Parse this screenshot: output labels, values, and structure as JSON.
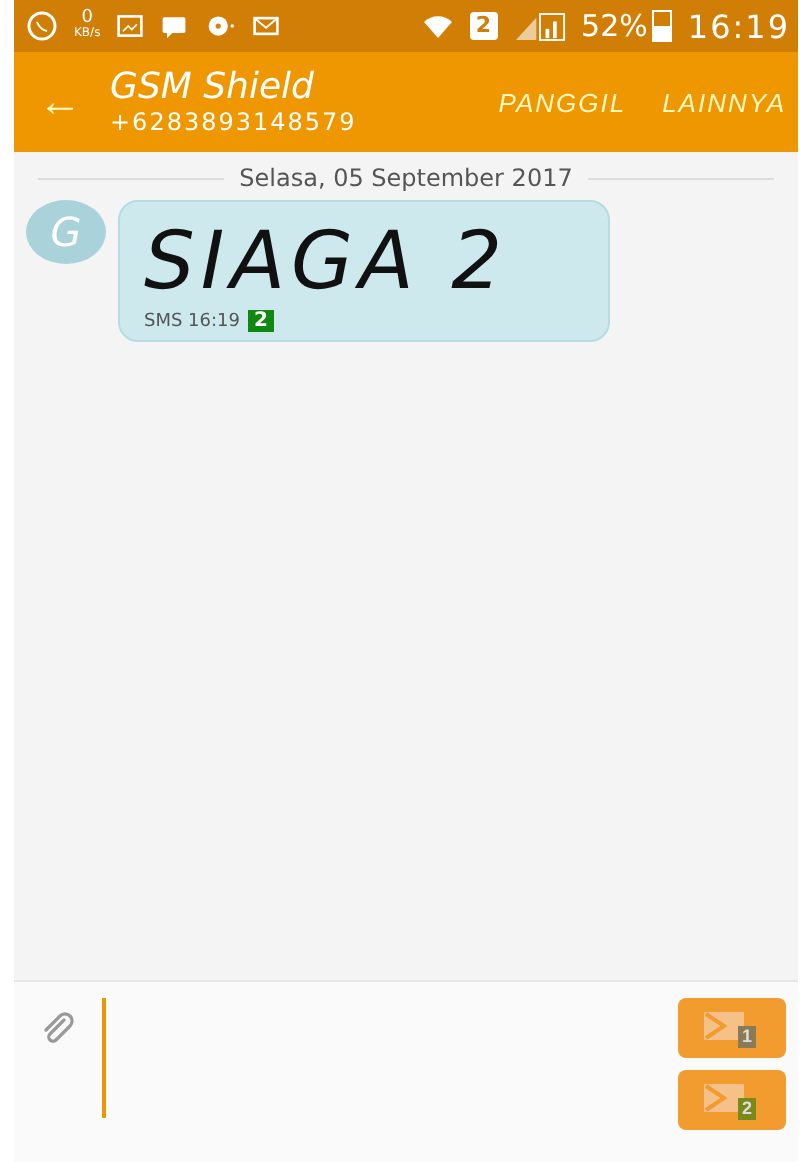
{
  "status_bar": {
    "net_speed": "0",
    "net_unit": "KB/s",
    "sim": "2",
    "battery": "52%",
    "time": "16:19"
  },
  "header": {
    "back": "←",
    "title": "GSM Shield",
    "subtitle": "+6283893148579",
    "actions": [
      "PANGGIL",
      "LAINNYA"
    ]
  },
  "date_divider": "Selasa, 05 September 2017",
  "messages": [
    {
      "avatar": "G",
      "text": "SIAGA 2",
      "meta": "SMS 16:19",
      "sim": "2"
    }
  ],
  "composer": {
    "send_buttons": [
      {
        "sim": "1",
        "color": "#8a7a55"
      },
      {
        "sim": "2",
        "color": "#7a8a1a"
      }
    ]
  }
}
